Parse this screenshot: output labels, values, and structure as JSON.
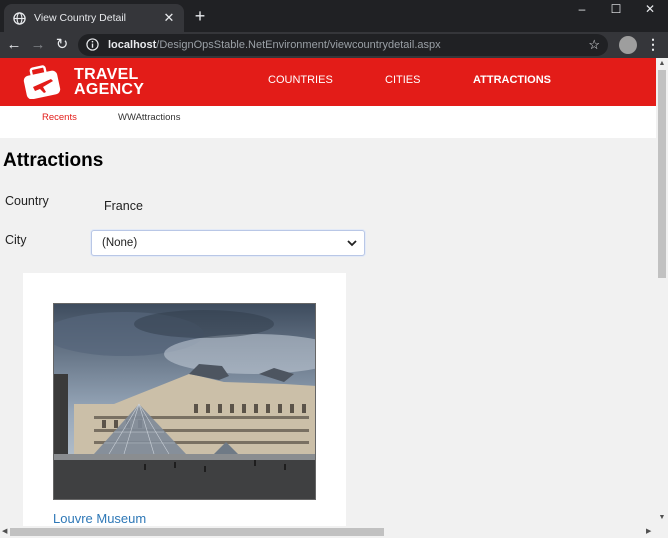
{
  "browser": {
    "tab_title": "View Country Detail",
    "tab_close": "✕",
    "new_tab": "+",
    "url_host": "localhost",
    "url_path": "/DesignOpsStable.NetEnvironment/viewcountrydetail.aspx",
    "minimize": "–",
    "maximize": "☐",
    "close": "✕",
    "back": "←",
    "forward": "→",
    "reload": "↻",
    "bookmark": "☆",
    "menu": "⋮"
  },
  "site": {
    "brand_line1": "TRAVEL",
    "brand_line2": "AGENCY",
    "nav": [
      {
        "label": "COUNTRIES"
      },
      {
        "label": "CITIES"
      },
      {
        "label": "ATTRACTIONS"
      }
    ],
    "subnav": [
      {
        "label": "Recents"
      },
      {
        "label": "WWAttractions"
      }
    ],
    "colors": {
      "brand_red": "#e31c18",
      "link_blue": "#2e78b7"
    }
  },
  "page": {
    "title": "Attractions",
    "country_label": "Country",
    "country_value": "France",
    "city_label": "City",
    "city_selected": "(None)"
  },
  "attractions": [
    {
      "name": "Louvre Museum"
    }
  ]
}
